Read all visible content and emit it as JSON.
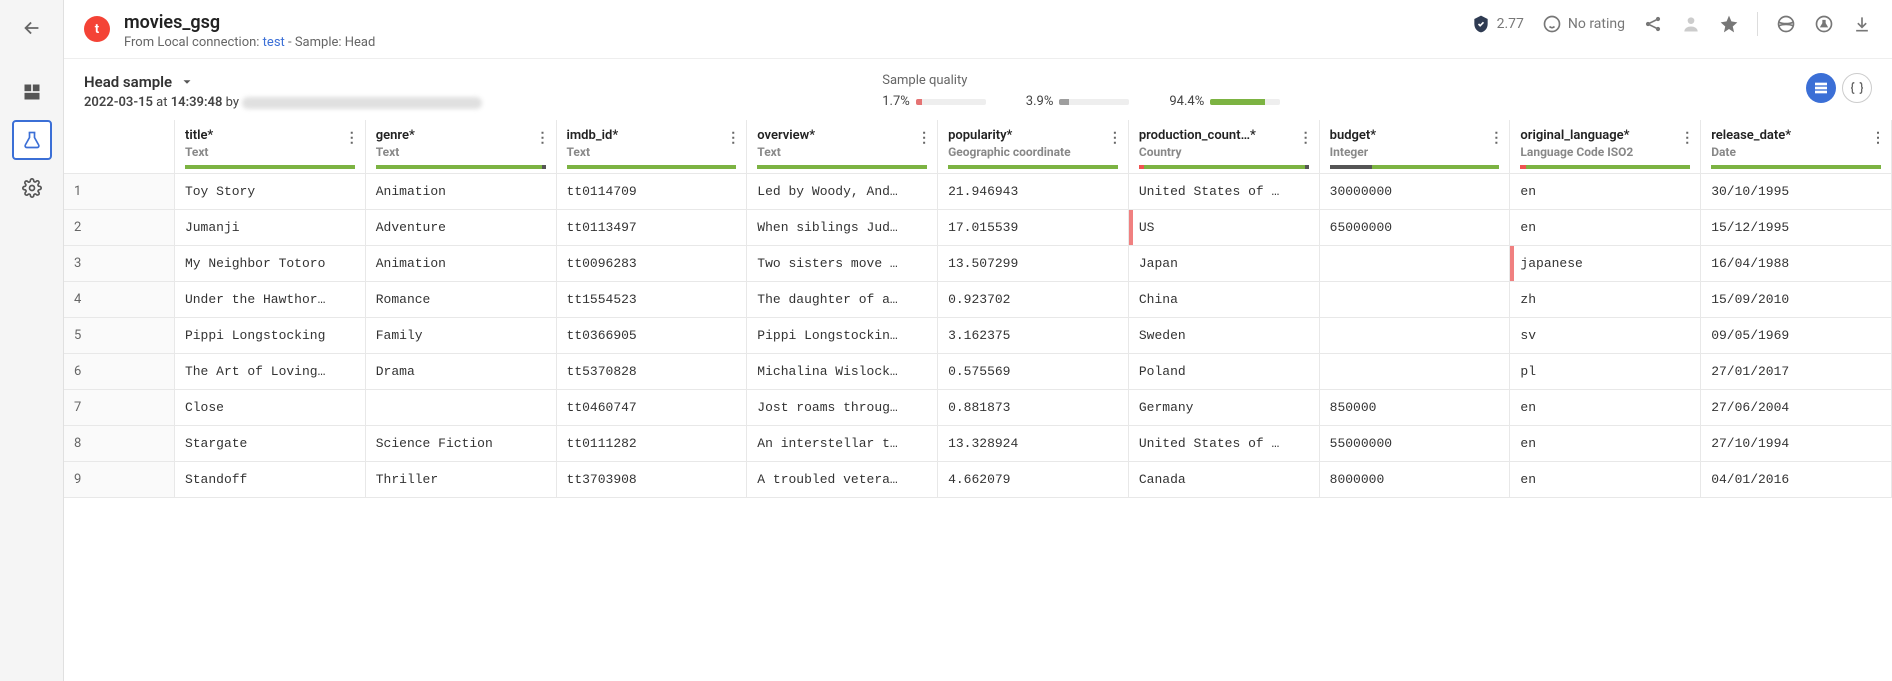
{
  "logo_letter": "t",
  "page_title": "movies_gsg",
  "subtitle_prefix": "From Local connection: ",
  "subtitle_link": "test",
  "subtitle_suffix": "  -  Sample: Head",
  "shield_value": "2.77",
  "rating_label": "No rating",
  "sample_selector": "Head sample",
  "sample_date": "2022-03-15",
  "sample_time": "14:39:48",
  "sample_by": " by ",
  "sample_at": " at ",
  "quality_label": "Sample quality",
  "quality": [
    {
      "pct": "1.7%",
      "color": "#e57373",
      "width": 6
    },
    {
      "pct": "3.9%",
      "color": "#9e9e9e",
      "width": 10
    },
    {
      "pct": "94.4%",
      "color": "#7cb342",
      "width": 55
    }
  ],
  "columns": [
    {
      "name": "title*",
      "type": "Text",
      "bar": [
        [
          "#7cb342",
          100
        ]
      ]
    },
    {
      "name": "genre*",
      "type": "Text",
      "bar": [
        [
          "#7cb342",
          98
        ],
        [
          "#555",
          2
        ]
      ]
    },
    {
      "name": "imdb_id*",
      "type": "Text",
      "bar": [
        [
          "#7cb342",
          100
        ]
      ]
    },
    {
      "name": "overview*",
      "type": "Text",
      "bar": [
        [
          "#7cb342",
          100
        ]
      ]
    },
    {
      "name": "popularity*",
      "type": "Geographic coordinate",
      "bar": [
        [
          "#7cb342",
          100
        ]
      ]
    },
    {
      "name": "production_count…*",
      "type": "Country",
      "bar": [
        [
          "#ef5350",
          3
        ],
        [
          "#7cb342",
          95
        ],
        [
          "#555",
          2
        ]
      ]
    },
    {
      "name": "budget*",
      "type": "Integer",
      "bar": [
        [
          "#555",
          25
        ],
        [
          "#7cb342",
          75
        ]
      ]
    },
    {
      "name": "original_language*",
      "type": "Language Code ISO2",
      "bar": [
        [
          "#ef5350",
          3
        ],
        [
          "#7cb342",
          97
        ]
      ]
    },
    {
      "name": "release_date*",
      "type": "Date",
      "bar": [
        [
          "#7cb342",
          100
        ]
      ]
    }
  ],
  "rows": [
    {
      "n": "1",
      "cells": [
        "Toy Story",
        "Animation",
        "tt0114709",
        "Led by Woody, And…",
        "21.946943",
        "United States of …",
        "30000000",
        "en",
        "30/10/1995"
      ],
      "flags": {}
    },
    {
      "n": "2",
      "cells": [
        "Jumanji",
        "Adventure",
        "tt0113497",
        "When siblings Jud…",
        "17.015539",
        "US",
        "65000000",
        "en",
        "15/12/1995"
      ],
      "flags": {
        "5": true
      }
    },
    {
      "n": "3",
      "cells": [
        "My Neighbor Totoro",
        "Animation",
        "tt0096283",
        "Two sisters move …",
        "13.507299",
        "Japan",
        "",
        "japanese",
        "16/04/1988"
      ],
      "flags": {
        "7": true
      }
    },
    {
      "n": "4",
      "cells": [
        "Under the Hawthor…",
        "Romance",
        "tt1554523",
        "The daughter of a…",
        "0.923702",
        "China",
        "",
        "zh",
        "15/09/2010"
      ],
      "flags": {}
    },
    {
      "n": "5",
      "cells": [
        "Pippi Longstocking",
        "Family",
        "tt0366905",
        "Pippi Longstockin…",
        "3.162375",
        "Sweden",
        "",
        "sv",
        "09/05/1969"
      ],
      "flags": {}
    },
    {
      "n": "6",
      "cells": [
        "The Art of Loving…",
        "Drama",
        "tt5370828",
        "Michalina Wislock…",
        "0.575569",
        "Poland",
        "",
        "pl",
        "27/01/2017"
      ],
      "flags": {}
    },
    {
      "n": "7",
      "cells": [
        "Close",
        "",
        "tt0460747",
        "Jost roams throug…",
        "0.881873",
        "Germany",
        "850000",
        "en",
        "27/06/2004"
      ],
      "flags": {}
    },
    {
      "n": "8",
      "cells": [
        "Stargate",
        "Science Fiction",
        "tt0111282",
        "An interstellar t…",
        "13.328924",
        "United States of …",
        "55000000",
        "en",
        "27/10/1994"
      ],
      "flags": {}
    },
    {
      "n": "9",
      "cells": [
        "Standoff",
        "Thriller",
        "tt3703908",
        "A troubled vetera…",
        "4.662079",
        "Canada",
        "8000000",
        "en",
        "04/01/2016"
      ],
      "flags": {}
    }
  ]
}
